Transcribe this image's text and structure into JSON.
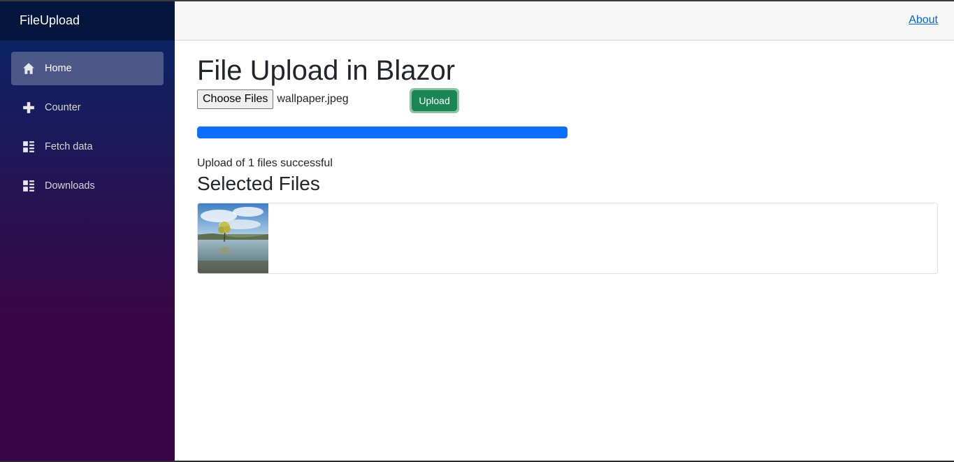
{
  "app": {
    "brand": "FileUpload"
  },
  "sidebar": {
    "items": [
      {
        "label": "Home",
        "icon": "home-icon",
        "active": true
      },
      {
        "label": "Counter",
        "icon": "plus-icon",
        "active": false
      },
      {
        "label": "Fetch data",
        "icon": "list-rich-icon",
        "active": false
      },
      {
        "label": "Downloads",
        "icon": "list-rich-icon",
        "active": false
      }
    ]
  },
  "topbar": {
    "about_label": "About"
  },
  "main": {
    "title": "File Upload in Blazor",
    "file_input": {
      "button_label": "Choose Files",
      "selected_file": "wallpaper.jpeg"
    },
    "upload_button": "Upload",
    "progress": 1.0,
    "status": "Upload of 1 files successful",
    "selected_files_title": "Selected Files"
  },
  "colors": {
    "sidebar_top": "#052767",
    "sidebar_bottom": "#3a0647",
    "progress": "#0d6efd",
    "upload_button": "#198754",
    "link": "#0366d6"
  }
}
